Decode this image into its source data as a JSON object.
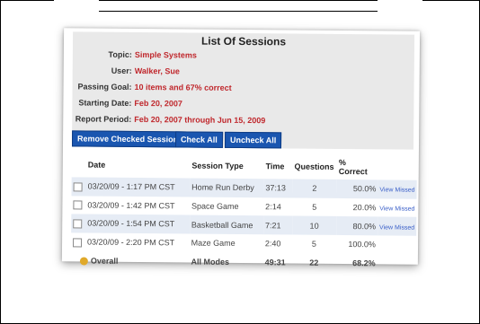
{
  "header": {
    "title": "List Of Sessions",
    "fields": [
      {
        "label": "Topic:",
        "value": "Simple Systems"
      },
      {
        "label": "User:",
        "value": "Walker, Sue"
      },
      {
        "label": "Passing Goal:",
        "value": "10 items and 67% correct"
      },
      {
        "label": "Starting Date:",
        "value": "Feb 20, 2007"
      },
      {
        "label": "Report Period:",
        "value": "Feb 20, 2007 through Jun 15, 2009"
      }
    ]
  },
  "buttons": {
    "remove": "Remove Checked Sessions",
    "check_all": "Check All",
    "uncheck_all": "Uncheck All"
  },
  "table": {
    "columns": [
      "Date",
      "Session Type",
      "Time",
      "Questions",
      "% Correct",
      ""
    ],
    "rows": [
      {
        "date": "03/20/09 - 1:17 PM CST",
        "type": "Home Run Derby",
        "time": "37:13",
        "questions": "2",
        "correct": "50.0%",
        "link": "View Missed"
      },
      {
        "date": "03/20/09 - 1:42 PM CST",
        "type": "Space Game",
        "time": "2:14",
        "questions": "5",
        "correct": "20.0%",
        "link": "View Missed"
      },
      {
        "date": "03/20/09 - 1:54 PM CST",
        "type": "Basketball Game",
        "time": "7:21",
        "questions": "10",
        "correct": "80.0%",
        "link": "View Missed"
      },
      {
        "date": "03/20/09 - 2:20 PM CST",
        "type": "Maze Game",
        "time": "2:40",
        "questions": "5",
        "correct": "100.0%",
        "link": ""
      }
    ],
    "overall": {
      "label": "Overall",
      "type": "All Modes",
      "time": "49:31",
      "questions": "22",
      "correct": "68.2%"
    }
  }
}
